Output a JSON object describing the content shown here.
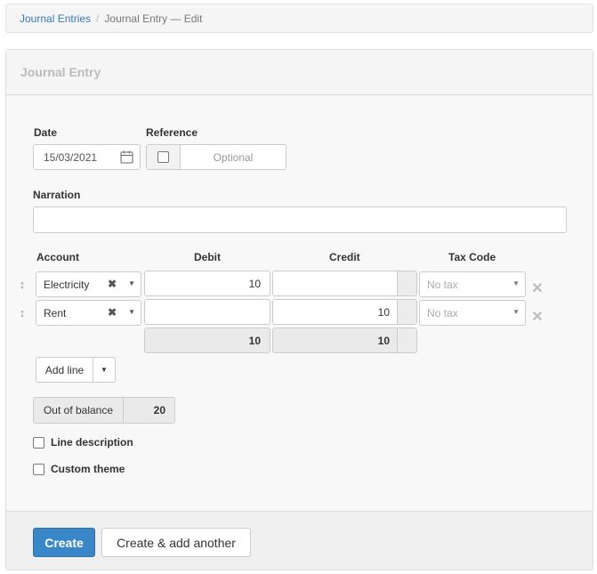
{
  "breadcrumb": {
    "link": "Journal Entries",
    "separator": "/",
    "current": "Journal Entry — Edit"
  },
  "panel": {
    "title": "Journal Entry"
  },
  "form": {
    "date_label": "Date",
    "date_value": "15/03/2021",
    "reference_label": "Reference",
    "reference_placeholder": "Optional",
    "narration_label": "Narration",
    "narration_value": ""
  },
  "lines": {
    "headers": {
      "account": "Account",
      "debit": "Debit",
      "credit": "Credit",
      "tax_code": "Tax Code"
    },
    "rows": [
      {
        "account": "Electricity",
        "debit": "10",
        "credit": "",
        "tax_code": "No tax"
      },
      {
        "account": "Rent",
        "debit": "",
        "credit": "10",
        "tax_code": "No tax"
      }
    ],
    "totals": {
      "debit": "10",
      "credit": "10"
    }
  },
  "add_line": {
    "label": "Add line"
  },
  "balance": {
    "label": "Out of balance",
    "value": "20"
  },
  "options": {
    "line_description": "Line description",
    "custom_theme": "Custom theme"
  },
  "footer": {
    "create": "Create",
    "create_add_another": "Create & add another"
  },
  "colors": {
    "primary": "#3a87c8",
    "link": "#337ab7"
  },
  "icons": {
    "date": "calendar-icon",
    "drag": "drag-handle-icon",
    "clear": "clear-x-icon",
    "caret": "chevron-down-icon",
    "remove": "remove-line-icon"
  }
}
